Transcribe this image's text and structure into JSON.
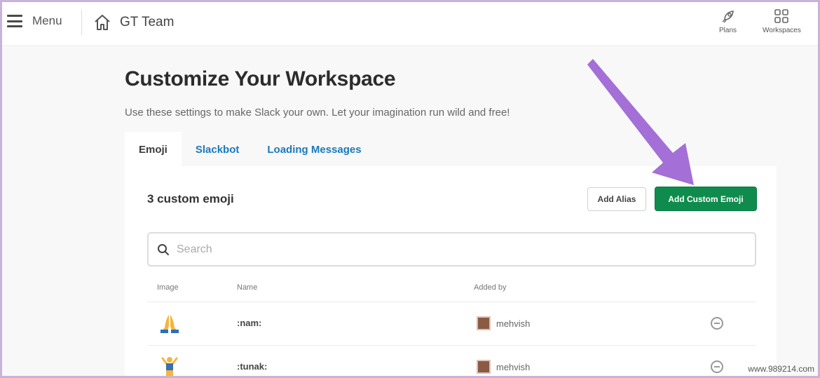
{
  "topbar": {
    "menu_label": "Menu",
    "team_name": "GT Team",
    "plans_label": "Plans",
    "workspaces_label": "Workspaces"
  },
  "page": {
    "title": "Customize Your Workspace",
    "subtitle": "Use these settings to make Slack your own. Let your imagination run wild and free!"
  },
  "tabs": [
    {
      "label": "Emoji",
      "active": true
    },
    {
      "label": "Slackbot",
      "active": false
    },
    {
      "label": "Loading Messages",
      "active": false
    }
  ],
  "emoji_panel": {
    "count_label": "3 custom emoji",
    "add_alias_label": "Add Alias",
    "add_custom_label": "Add Custom Emoji",
    "search_placeholder": "Search",
    "columns": {
      "image": "Image",
      "name": "Name",
      "added_by": "Added by"
    },
    "rows": [
      {
        "emoji_icon": "praying-hands-icon",
        "name": ":nam:",
        "added_by": "mehvish"
      },
      {
        "emoji_icon": "dancing-person-icon",
        "name": ":tunak:",
        "added_by": "mehvish"
      }
    ]
  },
  "watermark": "www.989214.com",
  "colors": {
    "accent_green": "#0f8c4d",
    "link_blue": "#1a79bd",
    "annotation_purple": "#a46fd6"
  }
}
